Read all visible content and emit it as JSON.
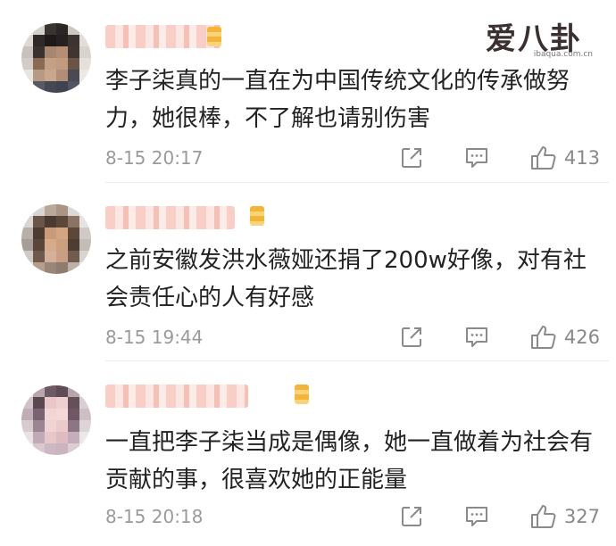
{
  "watermark": {
    "logo_text": "爱八卦",
    "site": "ibaqua.com.cn"
  },
  "comments": [
    {
      "text": "李子柒真的一直在为中国传统文化的传承做努力，她很棒，不了解也请别伤害",
      "time": "8-15 20:17",
      "likes": "413"
    },
    {
      "text": "之前安徽发洪水薇娅还捐了200w好像，对有社会责任心的人有好感",
      "time": "8-15 19:44",
      "likes": "426"
    },
    {
      "text": "一直把李子柒当成是偶像，她一直做着为社会有贡献的事，很喜欢她的正能量",
      "time": "8-15 20:18",
      "likes": "327"
    }
  ],
  "icons": {
    "share": "share-icon",
    "reply": "comment-icon",
    "like": "thumbs-up-icon"
  },
  "colors": {
    "meta_gray": "#9a9a9a",
    "username_blur": "#f7c9c0",
    "vip_badge": "#f2b53a"
  }
}
